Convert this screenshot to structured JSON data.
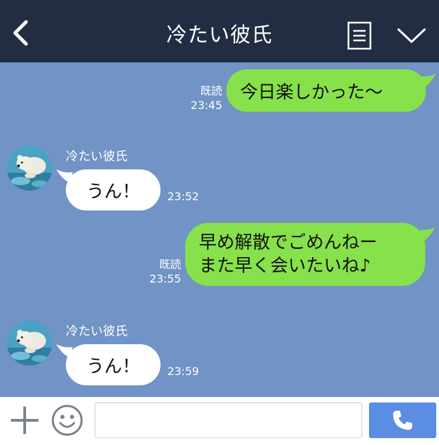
{
  "header": {
    "title": "冷たい彼氏",
    "back_icon": "chevron-left-icon",
    "menu_icon": "note-list-icon",
    "collapse_icon": "chevron-down-icon"
  },
  "messages": [
    {
      "side": "sent",
      "text": "今日楽しかった〜",
      "read_label": "既読",
      "time": "23:45"
    },
    {
      "side": "received",
      "sender": "冷たい彼氏",
      "text": "うん！",
      "time": "23:52",
      "avatar_icon": "polar-bear-avatar"
    },
    {
      "side": "sent",
      "lines": [
        "早め解散でごめんねー",
        "また早く会いたいね♪"
      ],
      "read_label": "既読",
      "time": "23:55"
    },
    {
      "side": "received",
      "sender": "冷たい彼氏",
      "text": "うん！",
      "time": "23:59",
      "avatar_icon": "polar-bear-avatar"
    }
  ],
  "input_bar": {
    "plus_icon": "plus-icon",
    "emoji_icon": "smiley-icon",
    "message_value": "",
    "call_icon": "phone-icon"
  },
  "colors": {
    "header": "#222d43",
    "chat_background": "#7193c5",
    "sent_bubble": "#86e14a",
    "received_bubble": "#ffffff",
    "call_button": "#5a8de3"
  }
}
